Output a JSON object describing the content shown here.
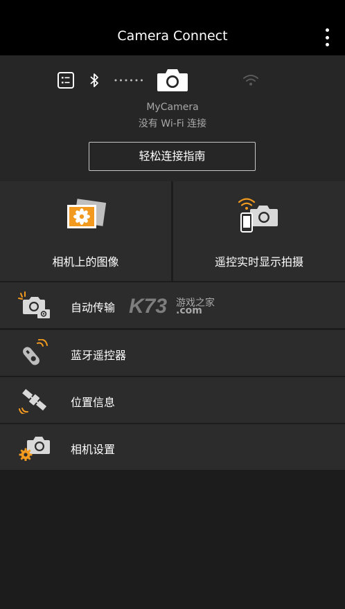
{
  "header": {
    "title": "Camera Connect"
  },
  "connection": {
    "camera_name": "MyCamera",
    "status": "没有 Wi-Fi 连接",
    "guide_button": "轻松连接指南"
  },
  "tiles": [
    {
      "label": "相机上的图像",
      "icon": "images-on-camera-icon"
    },
    {
      "label": "遥控实时显示拍摄",
      "icon": "remote-live-view-icon"
    }
  ],
  "menu": [
    {
      "label": "自动传输",
      "icon": "auto-transfer-icon"
    },
    {
      "label": "蓝牙遥控器",
      "icon": "bluetooth-remote-icon"
    },
    {
      "label": "位置信息",
      "icon": "location-satellite-icon"
    },
    {
      "label": "相机设置",
      "icon": "camera-settings-icon"
    }
  ],
  "watermark": {
    "brand": "K73",
    "text": "游戏之家",
    "domain": ".com"
  },
  "colors": {
    "accent_orange": "#f29a1f",
    "tile_bg": "#2c2c2c",
    "header_bg": "#000000",
    "conn_bg": "#262626"
  }
}
